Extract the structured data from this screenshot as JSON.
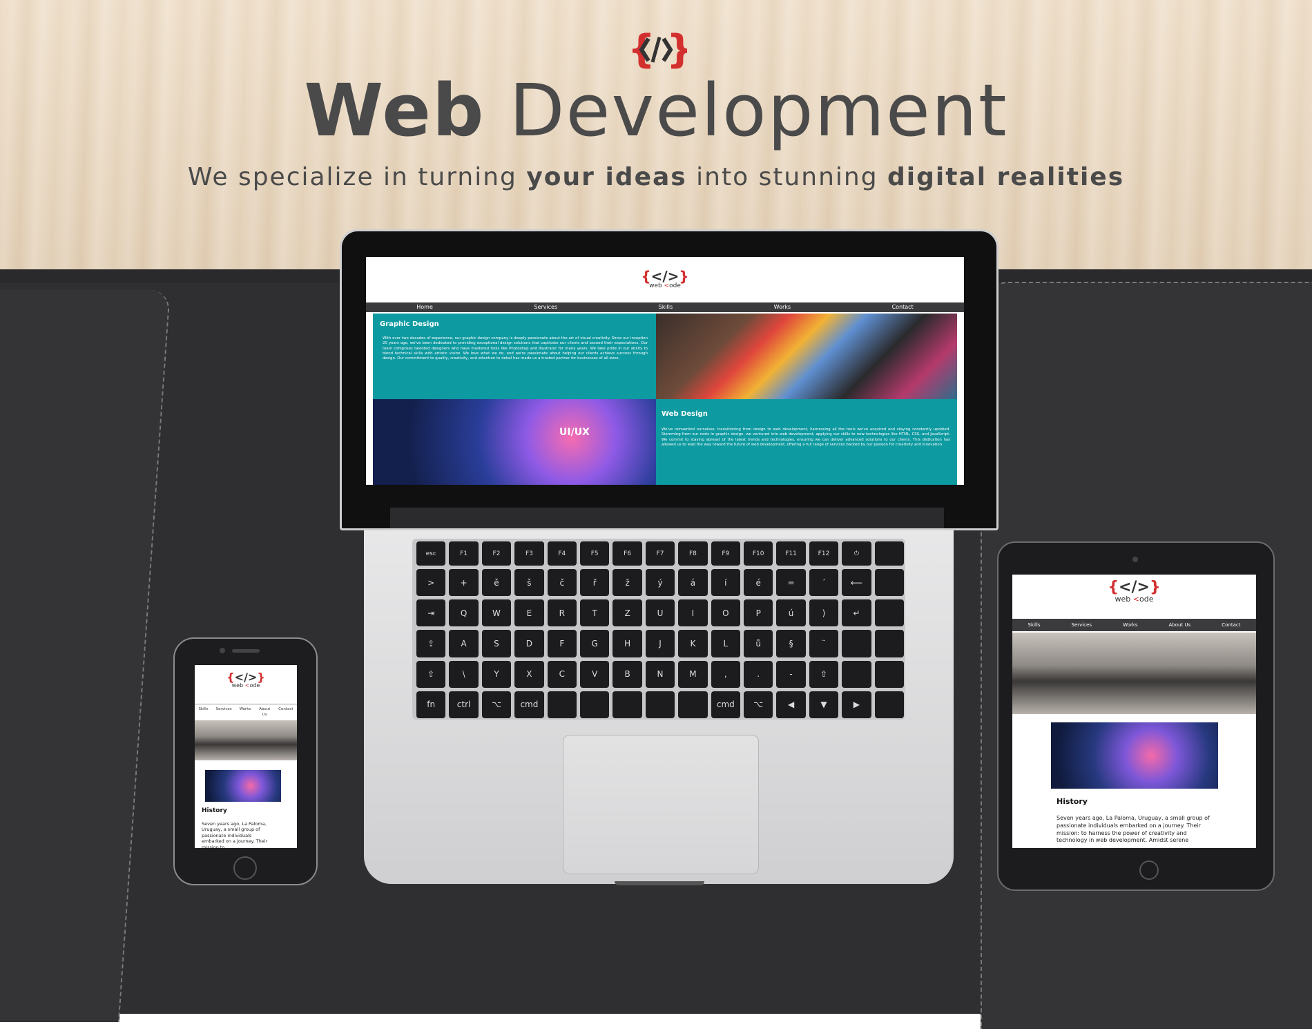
{
  "hero": {
    "logo_symbol": "{</>}",
    "title_bold": "Web",
    "title_light": "Development",
    "subtitle_parts": [
      "We specialize in turning ",
      "your ideas",
      " into stunning ",
      "digital realities"
    ]
  },
  "brand": {
    "wordmark_prefix": "web ",
    "wordmark_suffix": "ode",
    "accent_color": "#d32f2f",
    "teal_color": "#0e9aa1",
    "nav_bg": "#3b3b3d"
  },
  "laptop_site": {
    "nav": [
      "Home",
      "Services",
      "Skills",
      "Works",
      "Contact"
    ],
    "section1": {
      "heading": "Graphic Design",
      "body": "With over two decades of experience, our graphic design company is deeply passionate about the art of visual creativity. Since our inception 20 years ago, we've been dedicated to providing exceptional design solutions that captivate our clients and exceed their expectations. Our team comprises talented designers who have mastered tools like Photoshop and Illustrator for many years. We take pride in our ability to blend technical skills with artistic vision. We love what we do, and we're passionate about helping our clients achieve success through design. Our commitment to quality, creativity, and attention to detail has made us a trusted partner for businesses of all sizes."
    },
    "section2": {
      "heading": "Web Design",
      "body": "We've reinvented ourselves, transitioning from design to web development, harnessing all the tools we've acquired and staying constantly updated. Stemming from our roots in graphic design, we ventured into web development, applying our skills to new technologies like HTML, CSS, and JavaScript. We commit to staying abreast of the latest trends and technologies, ensuring we can deliver advanced solutions to our clients. This dedication has allowed us to lead the way toward the future of web development, offering a full range of services backed by our passion for creativity and innovation."
    },
    "uiux_label": "UI/UX"
  },
  "tablet_site": {
    "nav": [
      "Skills",
      "Services",
      "Works",
      "About Us",
      "Contact"
    ],
    "history_heading": "History",
    "history_body": "Seven years ago, La Paloma, Uruguay, a small group of passionate individuals embarked on a journey. Their mission: to harness the power of creativity and technology in web development. Amidst serene"
  },
  "phone_site": {
    "nav": [
      "Skills",
      "Services",
      "Works",
      "About Us",
      "Contact"
    ],
    "history_heading": "History",
    "history_body": "Seven years ago, La Paloma, Uruguay, a small group of passionate individuals embarked on a journey. Their mission to"
  },
  "keyboard": {
    "row_fn": [
      "esc",
      "F1",
      "F2",
      "F3",
      "F4",
      "F5",
      "F6",
      "F7",
      "F8",
      "F9",
      "F10",
      "F11",
      "F12",
      "⏻"
    ],
    "row1": [
      ">",
      "+",
      "ě",
      "š",
      "č",
      "ř",
      "ž",
      "ý",
      "á",
      "í",
      "é",
      "=",
      "´",
      "⟵"
    ],
    "row2": [
      "⇥",
      "Q",
      "W",
      "E",
      "R",
      "T",
      "Z",
      "U",
      "I",
      "O",
      "P",
      "ú",
      ")",
      "↵"
    ],
    "row3": [
      "⇪",
      "A",
      "S",
      "D",
      "F",
      "G",
      "H",
      "J",
      "K",
      "L",
      "ů",
      "§",
      "¨",
      ""
    ],
    "row4": [
      "⇧",
      "\\",
      "Y",
      "X",
      "C",
      "V",
      "B",
      "N",
      "M",
      ",",
      ".",
      "-",
      "⇧",
      ""
    ],
    "row5": [
      "fn",
      "ctrl",
      "⌥",
      "cmd",
      "",
      "",
      "",
      "",
      "",
      "cmd",
      "⌥",
      "◀",
      "▼",
      "▶"
    ]
  }
}
